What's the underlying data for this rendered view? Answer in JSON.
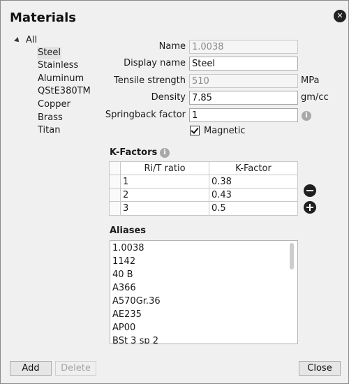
{
  "dialog": {
    "title": "Materials"
  },
  "tree": {
    "root": "All",
    "items": [
      "Steel",
      "Stainless",
      "Aluminum",
      "QStE380TM",
      "Copper",
      "Brass",
      "Titan"
    ],
    "selected_index": 0
  },
  "form": {
    "name_label": "Name",
    "name_value": "1.0038",
    "display_label": "Display name",
    "display_value": "Steel",
    "tensile_label": "Tensile strength",
    "tensile_value": "510",
    "tensile_unit": "MPa",
    "density_label": "Density",
    "density_value": "7.85",
    "density_unit": "gm/cc",
    "spring_label": "Springback factor",
    "spring_value": "1",
    "magnetic_label": "Magnetic",
    "magnetic_checked": true
  },
  "kfactors": {
    "title": "K-Factors",
    "headers": [
      "Ri/T ratio",
      "K-Factor"
    ],
    "rows": [
      [
        "1",
        "0.38"
      ],
      [
        "2",
        "0.43"
      ],
      [
        "3",
        "0.5"
      ]
    ]
  },
  "aliases": {
    "title": "Aliases",
    "items": [
      "1.0038",
      "1142",
      "40 B",
      "A366",
      "A570Gr.36",
      "AE235",
      "AP00",
      "BSt 3 sp 2"
    ]
  },
  "buttons": {
    "add": "Add",
    "delete": "Delete",
    "close": "Close"
  },
  "icons": {
    "close": "close-icon",
    "info": "info-icon",
    "minus": "minus-circle-icon",
    "plus": "plus-circle-icon",
    "expand": "tree-expand-icon"
  }
}
